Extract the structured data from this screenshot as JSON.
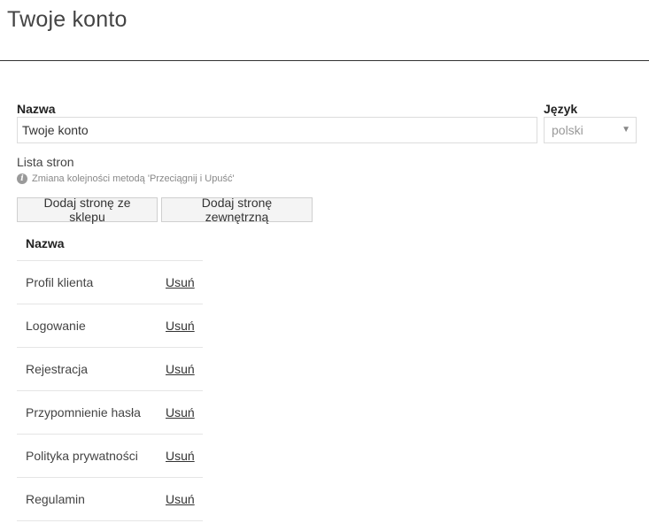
{
  "header": {
    "title": "Twoje konto"
  },
  "form": {
    "name_label": "Nazwa",
    "name_value": "Twoje konto",
    "language_label": "Język",
    "language_value": "polski"
  },
  "pages": {
    "label": "Lista stron",
    "hint": "Zmiana kolejności metodą 'Przeciągnij i Upuść'",
    "add_shop_page_label": "Dodaj stronę ze sklepu",
    "add_external_page_label": "Dodaj stronę zewnętrzną",
    "table_header": "Nazwa",
    "rows": [
      {
        "name": "Profil klienta",
        "action": "Usuń"
      },
      {
        "name": "Logowanie",
        "action": "Usuń"
      },
      {
        "name": "Rejestracja",
        "action": "Usuń"
      },
      {
        "name": "Przypomnienie hasła",
        "action": "Usuń"
      },
      {
        "name": "Polityka prywatności",
        "action": "Usuń"
      },
      {
        "name": "Regulamin",
        "action": "Usuń"
      }
    ]
  }
}
